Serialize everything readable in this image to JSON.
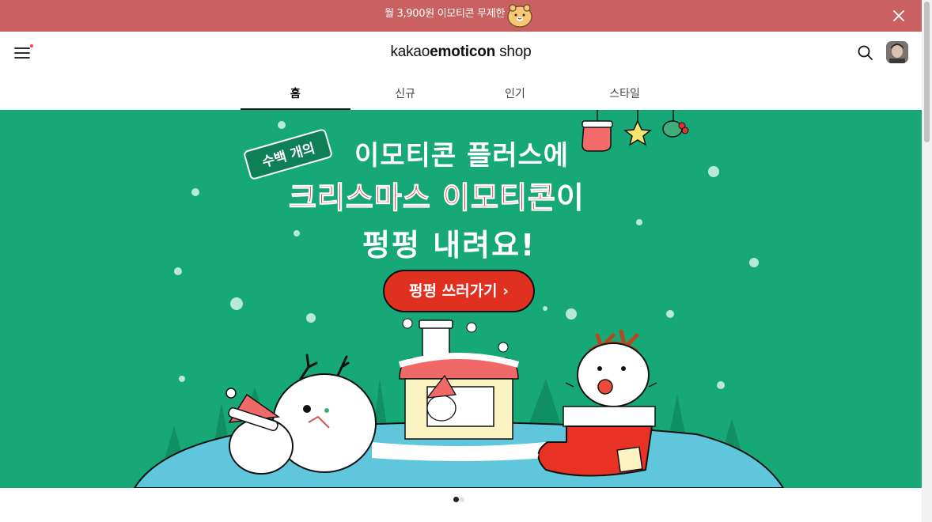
{
  "promo": {
    "text": "월 3,900원 이모티콘 무제한",
    "mascot_icon": "hamster-mascot-icon",
    "close_icon": "close-icon",
    "background": "#c8615f"
  },
  "header": {
    "menu_icon": "hamburger-menu-icon",
    "logo_part1": "kakao",
    "logo_part2": "emoticon",
    "logo_part3": " shop",
    "search_icon": "search-icon",
    "avatar": "user-avatar"
  },
  "tabs": [
    {
      "label": "홈",
      "active": true
    },
    {
      "label": "신규",
      "active": false
    },
    {
      "label": "인기",
      "active": false
    },
    {
      "label": "스타일",
      "active": false
    }
  ],
  "hero": {
    "tag": "수백 개의",
    "line1": "이모티콘 플러스에",
    "line2_red": "크리스마스 이모티콘",
    "line2_white": "이",
    "line3": "펑펑 내려요!",
    "cta": "펑펑 쓰러가기 ›",
    "background": "#17a877"
  },
  "pagination": {
    "active_index": 0,
    "total": 2
  }
}
